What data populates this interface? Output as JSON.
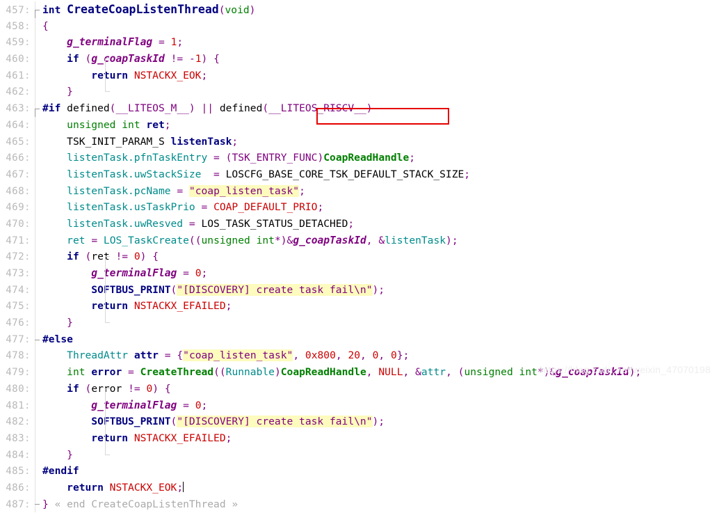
{
  "editor": {
    "background": "#ffffff",
    "gutter_color": "#b9b9b9",
    "watermark": "https://blog.csdn.net/weixin_47070198",
    "highlight_box_color": "#e60000",
    "string_highlight_color": "#fdfbbd",
    "language": "C"
  },
  "lines": [
    {
      "num": "457",
      "text": "int CreateCoapListenThread(void)"
    },
    {
      "num": "458",
      "text": "{"
    },
    {
      "num": "459",
      "text": "    g_terminalFlag = 1;"
    },
    {
      "num": "460",
      "text": "    if (g_coapTaskId != -1) {"
    },
    {
      "num": "461",
      "text": "        return NSTACKX_EOK;"
    },
    {
      "num": "462",
      "text": "    }"
    },
    {
      "num": "463",
      "text": "#if defined(__LITEOS_M__) || defined(__LITEOS_RISCV__)"
    },
    {
      "num": "464",
      "text": "    unsigned int ret;"
    },
    {
      "num": "465",
      "text": "    TSK_INIT_PARAM_S listenTask;"
    },
    {
      "num": "466",
      "text": "    listenTask.pfnTaskEntry = (TSK_ENTRY_FUNC)CoapReadHandle;"
    },
    {
      "num": "467",
      "text": "    listenTask.uwStackSize  = LOSCFG_BASE_CORE_TSK_DEFAULT_STACK_SIZE;"
    },
    {
      "num": "468",
      "text": "    listenTask.pcName = \"coap_listen_task\";"
    },
    {
      "num": "469",
      "text": "    listenTask.usTaskPrio = COAP_DEFAULT_PRIO;"
    },
    {
      "num": "470",
      "text": "    listenTask.uwResved = LOS_TASK_STATUS_DETACHED;"
    },
    {
      "num": "471",
      "text": "    ret = LOS_TaskCreate((unsigned int*)&g_coapTaskId, &listenTask);"
    },
    {
      "num": "472",
      "text": "    if (ret != 0) {"
    },
    {
      "num": "473",
      "text": "        g_terminalFlag = 0;"
    },
    {
      "num": "474",
      "text": "        SOFTBUS_PRINT(\"[DISCOVERY] create task fail\\n\");"
    },
    {
      "num": "475",
      "text": "        return NSTACKX_EFAILED;"
    },
    {
      "num": "476",
      "text": "    }"
    },
    {
      "num": "477",
      "text": "#else"
    },
    {
      "num": "478",
      "text": "    ThreadAttr attr = {\"coap_listen_task\", 0x800, 20, 0, 0};"
    },
    {
      "num": "479",
      "text": "    int error = CreateThread((Runnable)CoapReadHandle, NULL, &attr, (unsigned int*)&g_coapTaskId);"
    },
    {
      "num": "480",
      "text": "    if (error != 0) {"
    },
    {
      "num": "481",
      "text": "        g_terminalFlag = 0;"
    },
    {
      "num": "482",
      "text": "        SOFTBUS_PRINT(\"[DISCOVERY] create task fail\\n\");"
    },
    {
      "num": "483",
      "text": "        return NSTACKX_EFAILED;"
    },
    {
      "num": "484",
      "text": "    }"
    },
    {
      "num": "485",
      "text": "#endif"
    },
    {
      "num": "486",
      "text": "    return NSTACKX_EOK;"
    },
    {
      "num": "487",
      "text": "} « end CreateCoapListenThread »"
    }
  ],
  "annotation": {
    "boxed_token": "CoapReadHandle",
    "boxed_line": "466"
  },
  "fold_comment": "« end CreateCoapListenThread »",
  "strings": [
    "\"coap_listen_task\"",
    "\"[DISCOVERY] create task fail\\n\""
  ],
  "symbols": {
    "function_name": "CreateCoapListenThread",
    "globals": [
      "g_terminalFlag",
      "g_coapTaskId"
    ],
    "locals": [
      "ret",
      "listenTask",
      "attr",
      "error"
    ],
    "constants": [
      "NSTACKX_EOK",
      "NSTACKX_EFAILED",
      "COAP_DEFAULT_PRIO",
      "LOS_TASK_STATUS_DETACHED",
      "LOSCFG_BASE_CORE_TSK_DEFAULT_STACK_SIZE"
    ],
    "calls": [
      "LOS_TaskCreate",
      "CreateThread",
      "SOFTBUS_PRINT",
      "CoapReadHandle"
    ],
    "macros": [
      "__LITEOS_M__",
      "__LITEOS_RISCV__"
    ]
  }
}
